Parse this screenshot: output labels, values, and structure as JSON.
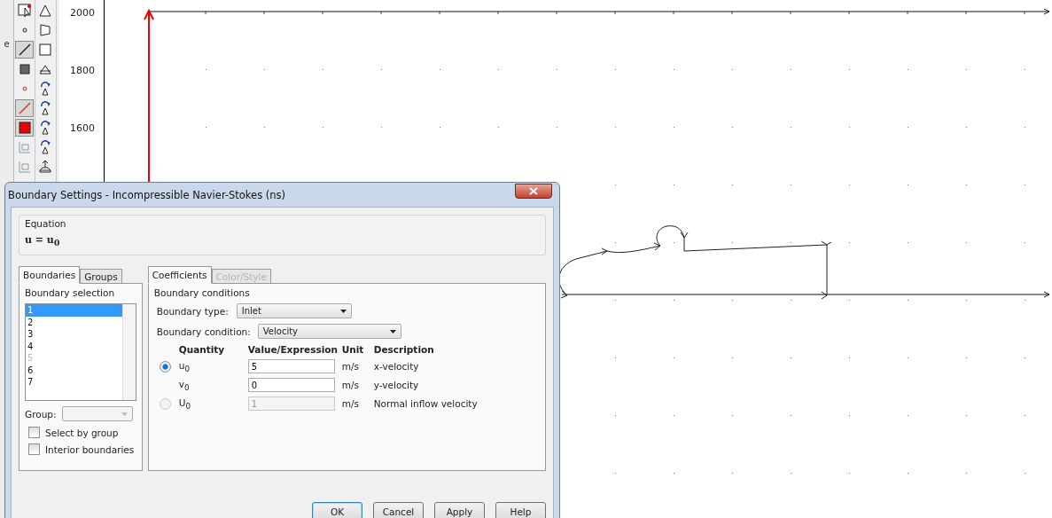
{
  "side_fragment": "e",
  "toolbars": [
    [
      {
        "kind": "pointer",
        "selected": false
      },
      {
        "kind": "point",
        "selected": false
      },
      {
        "kind": "line",
        "selected": true
      },
      {
        "kind": "square",
        "selected": false
      },
      {
        "kind": "red-point",
        "selected": false
      },
      {
        "kind": "red-line",
        "selected": true
      },
      {
        "kind": "red-square",
        "selected": true
      },
      {
        "kind": "grid",
        "selected": false
      },
      {
        "kind": "grid",
        "selected": false
      }
    ],
    [
      {
        "kind": "triangle"
      },
      {
        "kind": "trapezoid"
      },
      {
        "kind": "rectangle"
      },
      {
        "kind": "cone"
      },
      {
        "kind": "rotate-triangle"
      },
      {
        "kind": "rotate-trapezoid"
      },
      {
        "kind": "rotate-rectangle"
      },
      {
        "kind": "rotate-cone"
      },
      {
        "kind": "extrude"
      }
    ]
  ],
  "y_ticks": [
    "2000",
    "1800",
    "1600"
  ],
  "dialog": {
    "title": "Boundary Settings - Incompressible Navier-Stokes (ns)",
    "equation_label": "Equation",
    "equation": "u = u$_{0}$",
    "left_tabs": [
      {
        "label": "Boundaries",
        "selected": true,
        "disabled": false
      },
      {
        "label": "Groups",
        "selected": false,
        "disabled": false
      }
    ],
    "selection_label": "Boundary selection",
    "boundaries": [
      {
        "label": "1",
        "selected": true,
        "disabled": false
      },
      {
        "label": "2",
        "selected": false,
        "disabled": false
      },
      {
        "label": "3",
        "selected": false,
        "disabled": false
      },
      {
        "label": "4",
        "selected": false,
        "disabled": false
      },
      {
        "label": "5",
        "selected": false,
        "disabled": true
      },
      {
        "label": "6",
        "selected": false,
        "disabled": false
      },
      {
        "label": "7",
        "selected": false,
        "disabled": false
      }
    ],
    "group_label": "Group:",
    "checkboxes": [
      {
        "label": "Select by group",
        "checked": false
      },
      {
        "label": "Interior boundaries",
        "checked": false
      }
    ],
    "right_tabs": [
      {
        "label": "Coefficients",
        "selected": true,
        "disabled": false
      },
      {
        "label": "Color/Style",
        "selected": false,
        "disabled": true
      }
    ],
    "conditions_label": "Boundary conditions",
    "selects": [
      {
        "label": "Boundary type:",
        "value": "Inlet"
      },
      {
        "label": "Boundary condition:",
        "value": "Velocity"
      }
    ],
    "columns": [
      "Quantity",
      "Value/Expression",
      "Unit",
      "Description"
    ],
    "rows": [
      {
        "kind": "radio",
        "selected": true,
        "disabled": false,
        "quantity": "u$_{0}$",
        "value": "5",
        "unit": "m/s",
        "description": "x-velocity"
      },
      {
        "kind": "plain",
        "disabled": false,
        "quantity": "v$_{0}$",
        "value": "0",
        "unit": "m/s",
        "description": "y-velocity"
      },
      {
        "kind": "radio",
        "selected": false,
        "disabled": true,
        "quantity": "U$_{0}$",
        "value": "1",
        "unit": "m/s",
        "description": "Normal inflow velocity"
      }
    ],
    "buttons": [
      {
        "label": "OK",
        "default": true
      },
      {
        "label": "Cancel",
        "default": false
      },
      {
        "label": "Apply",
        "default": false
      },
      {
        "label": "Help",
        "default": false
      }
    ]
  }
}
